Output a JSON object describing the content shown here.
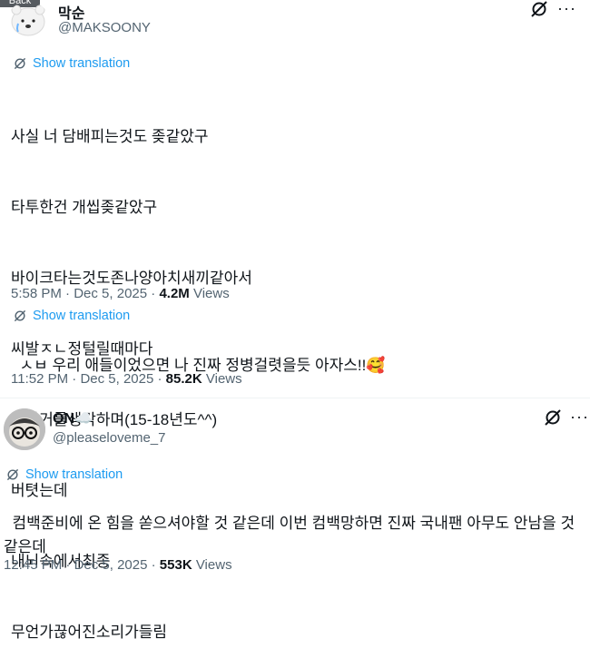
{
  "top_overlay": {
    "back_label": "Back"
  },
  "tweet1": {
    "display_name": "막순",
    "handle": "@MAKSOONY",
    "translate_label": "Show translation",
    "lines": [
      "사실 너 담배피는것도 좆같았구",
      "타투한건 개씹좆같았구",
      "바이크타는것도존나양아치새끼같아서",
      "씨발ㅈㄴ정털릴때마다",
      "니과거를생각하며(15-18년도^^)",
      "버텻는데",
      "내뇌속에서최종",
      "무언가끊어진소리가들림"
    ],
    "time": "5:58 PM",
    "date": "Dec 5, 2025",
    "views_count": "4.2M",
    "views_label": "Views"
  },
  "tweet2": {
    "translate_label": "Show translation",
    "text": "ㅅㅂ 우리 애들이었으면 나 진짜 정병걸렷을듯 아자스!!",
    "emoji": "🥰",
    "time": "11:52 PM",
    "date": "Dec 5, 2025",
    "views_count": "85.2K",
    "views_label": "Views"
  },
  "tweet3": {
    "display_name": "ON",
    "name_emoji": "☁️",
    "handle": "@pleaseloveme_7",
    "translate_label": "Show translation",
    "text": "컴백준비에 온 힘을 쏟으셔야할 것 같은데 이번 컴백망하면 진짜 국내팬 아무도 안남을 것 같은데",
    "time": "12:45 PM",
    "date": "Dec 5, 2025",
    "views_count": "553K",
    "views_label": "Views"
  },
  "icons": [
    "grok-icon",
    "more-icon",
    "translate-icon",
    "avatar"
  ]
}
